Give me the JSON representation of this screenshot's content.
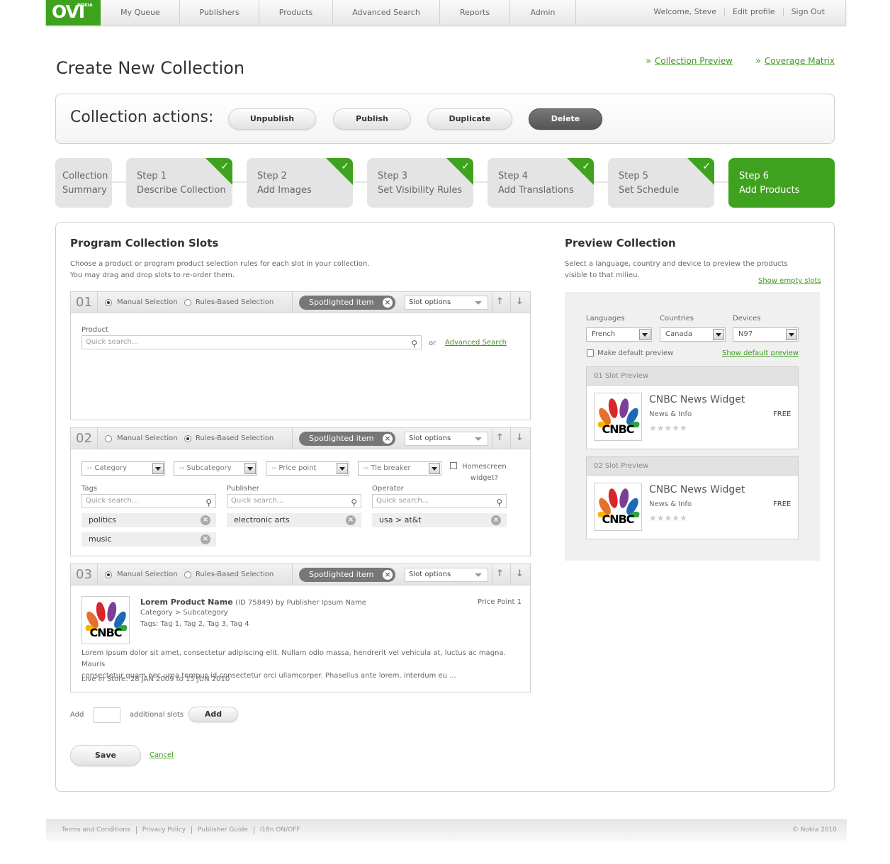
{
  "nav": {
    "logo_text": "OVI",
    "logo_brand": "NOKIA",
    "items": [
      "My Queue",
      "Publishers",
      "Products",
      "Advanced Search",
      "Reports",
      "Admin"
    ],
    "welcome": "Welcome, Steve",
    "edit_profile": "Edit profile",
    "sign_out": "Sign Out"
  },
  "page": {
    "title": "Create New Collection",
    "link_preview": "Collection Preview",
    "link_matrix": "Coverage Matrix",
    "link_marker": "»"
  },
  "actions": {
    "title": "Collection actions:",
    "buttons": [
      "Unpublish",
      "Publish",
      "Duplicate",
      "Delete"
    ]
  },
  "steps": [
    {
      "line1": "Collection",
      "line2": "Summary",
      "done": false,
      "active": false
    },
    {
      "line1": "Step 1",
      "line2": "Describe Collection",
      "done": true,
      "active": false
    },
    {
      "line1": "Step 2",
      "line2": "Add Images",
      "done": true,
      "active": false
    },
    {
      "line1": "Step 3",
      "line2": "Set Visibility Rules",
      "done": true,
      "active": false
    },
    {
      "line1": "Step 4",
      "line2": "Add Translations",
      "done": true,
      "active": false
    },
    {
      "line1": "Step 5",
      "line2": "Set Schedule",
      "done": true,
      "active": false
    },
    {
      "line1": "Step 6",
      "line2": "Add Products",
      "done": false,
      "active": true
    }
  ],
  "program": {
    "title": "Program Collection Slots",
    "intro_1": "Choose a product or program product selection rules for each slot in your collection.",
    "intro_2": "You may drag and drop slots to re-order them.",
    "manual_label": "Manual Selection",
    "rules_label": "Rules-Based Selection",
    "spotlight_label": "Spotlighted item",
    "slot_options": "Slot options",
    "quick_search": "Quick search..."
  },
  "slot1": {
    "num": "01",
    "product_label": "Product",
    "or": "or",
    "advanced_search": "Advanced Search"
  },
  "slot2": {
    "num": "02",
    "category": "-- Category",
    "subcategory": "-- Subcategory",
    "price_point": "-- Price point",
    "tie_breaker": "-- Tie breaker",
    "homescreen_1": "Homescreen",
    "homescreen_2": "widget?",
    "tags_label": "Tags",
    "publisher_label": "Publisher",
    "operator_label": "Operator",
    "tags": [
      "politics",
      "music"
    ],
    "publishers": [
      "electronic arts"
    ],
    "operators": [
      "usa > at&t"
    ]
  },
  "slot3": {
    "num": "03",
    "product_name": "Lorem Product Name",
    "product_id": "(ID 75849)",
    "by_publisher": "by Publisher Ipsum Name",
    "category_line": "Category > Subcategory",
    "tags_line": "Tags: Tag 1, Tag 2, Tag 3, Tag 4",
    "price_point": "Price Point 1",
    "description_1": "Lorem ipsum dolor sit amet, consectetur adipiscing elit. Nullam odio massa, hendrerit vel vehicula at, luctus ac magna. Mauris",
    "description_2": "consectetur quam nec urna tempus id consectetur orci ullamcorper. Phasellus ante lorem, interdum eu ...",
    "live": "Live in Store: 28 JAN 2009 to 15 JUN 2010",
    "logo_text": "CNBC"
  },
  "add_slots": {
    "add": "Add",
    "additional": "additional slots",
    "button": "Add",
    "value": ""
  },
  "form": {
    "save": "Save",
    "cancel": "Cancel"
  },
  "preview": {
    "title": "Preview Collection",
    "intro_1": "Select a language, country and device to preview the products",
    "intro_2": "visible to that milieu.",
    "show_empty": "Show empty slots",
    "languages_label": "Languages",
    "countries_label": "Countries",
    "devices_label": "Devices",
    "language": "French",
    "country": "Canada",
    "device": "N97",
    "make_default": "Make default preview",
    "show_default": "Show default preview",
    "slots": [
      {
        "header": "01 Slot Preview",
        "name": "CNBC News Widget",
        "category": "News & Info",
        "price": "FREE",
        "stars": "★★★★★",
        "logo": "CNBC"
      },
      {
        "header": "02 Slot Preview",
        "name": "CNBC News Widget",
        "category": "News & Info",
        "price": "FREE",
        "stars": "★★★★★",
        "logo": "CNBC"
      }
    ]
  },
  "footer": {
    "links": [
      "Terms and Conditions",
      "Privacy Policy",
      "Publisher Guide",
      "i18n ON/OFF"
    ],
    "copyright": "© Nokia 2010"
  },
  "colors": {
    "brand_green": "#3fa21e",
    "link_green": "#3f9a1e",
    "dark_button": "#555555"
  }
}
